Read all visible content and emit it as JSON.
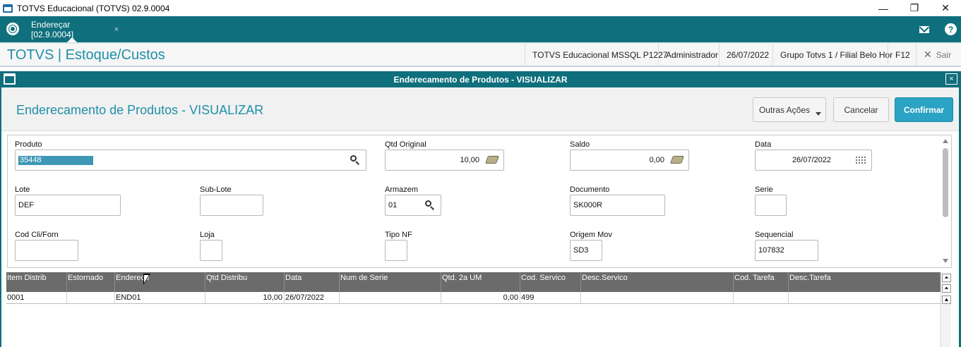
{
  "window": {
    "title": "TOTVS Educacional (TOTVS) 02.9.0004",
    "minimize": "—",
    "restore": "❐",
    "close": "✕"
  },
  "tabs": [
    {
      "label": "Endereçar [02.9.0004]",
      "close": "×"
    }
  ],
  "header": {
    "module": "TOTVS | Estoque/Custos",
    "environment": "TOTVS Educacional MSSQL P1227",
    "user": "Administrador",
    "date": "26/07/2022",
    "branch": "Grupo Totvs 1 / Filial Belo Hor",
    "shortcut": "F12",
    "exit": "Sair"
  },
  "dialog": {
    "title": "Enderecamento de Produtos - VISUALIZAR",
    "heading": "Enderecamento de Produtos - VISUALIZAR",
    "close": "×",
    "buttons": {
      "other_actions": "Outras Ações",
      "cancel": "Cancelar",
      "confirm": "Confirmar"
    }
  },
  "form": {
    "produto": {
      "label": "Produto",
      "value": "35448"
    },
    "qtd_original": {
      "label": "Qtd Original",
      "value": "10,00"
    },
    "saldo": {
      "label": "Saldo",
      "value": "0,00"
    },
    "data": {
      "label": "Data",
      "value": "26/07/2022"
    },
    "lote": {
      "label": "Lote",
      "value": "DEF"
    },
    "sub_lote": {
      "label": "Sub-Lote",
      "value": ""
    },
    "armazem": {
      "label": "Armazem",
      "value": "01"
    },
    "documento": {
      "label": "Documento",
      "value": "SK000R"
    },
    "serie": {
      "label": "Serie",
      "value": ""
    },
    "cod_cli_forn": {
      "label": "Cod Cli/Forn",
      "value": ""
    },
    "loja": {
      "label": "Loja",
      "value": ""
    },
    "tipo_nf": {
      "label": "Tipo NF",
      "value": ""
    },
    "origem_mov": {
      "label": "Origem Mov",
      "value": "SD3"
    },
    "sequencial": {
      "label": "Sequencial",
      "value": "107832"
    }
  },
  "grid": {
    "columns": [
      "Item Distrib",
      "Estornado",
      "Endereco",
      "Qtd Distribu",
      "Data",
      "Num de Serie",
      "Qtd. 2a UM",
      "Cod. Servico",
      "Desc.Servico",
      "Cod. Tarefa",
      "Desc.Tarefa"
    ],
    "rows": [
      [
        "0001",
        "",
        "END01",
        "10,00",
        "26/07/2022",
        "",
        "0,00",
        "499",
        "",
        "",
        ""
      ]
    ],
    "scroll_top": "⏶",
    "scroll_up": "▲"
  },
  "colors": {
    "teal": "#0f6f7c",
    "accent": "#1f8fa8",
    "confirm": "#2aa3c4"
  }
}
